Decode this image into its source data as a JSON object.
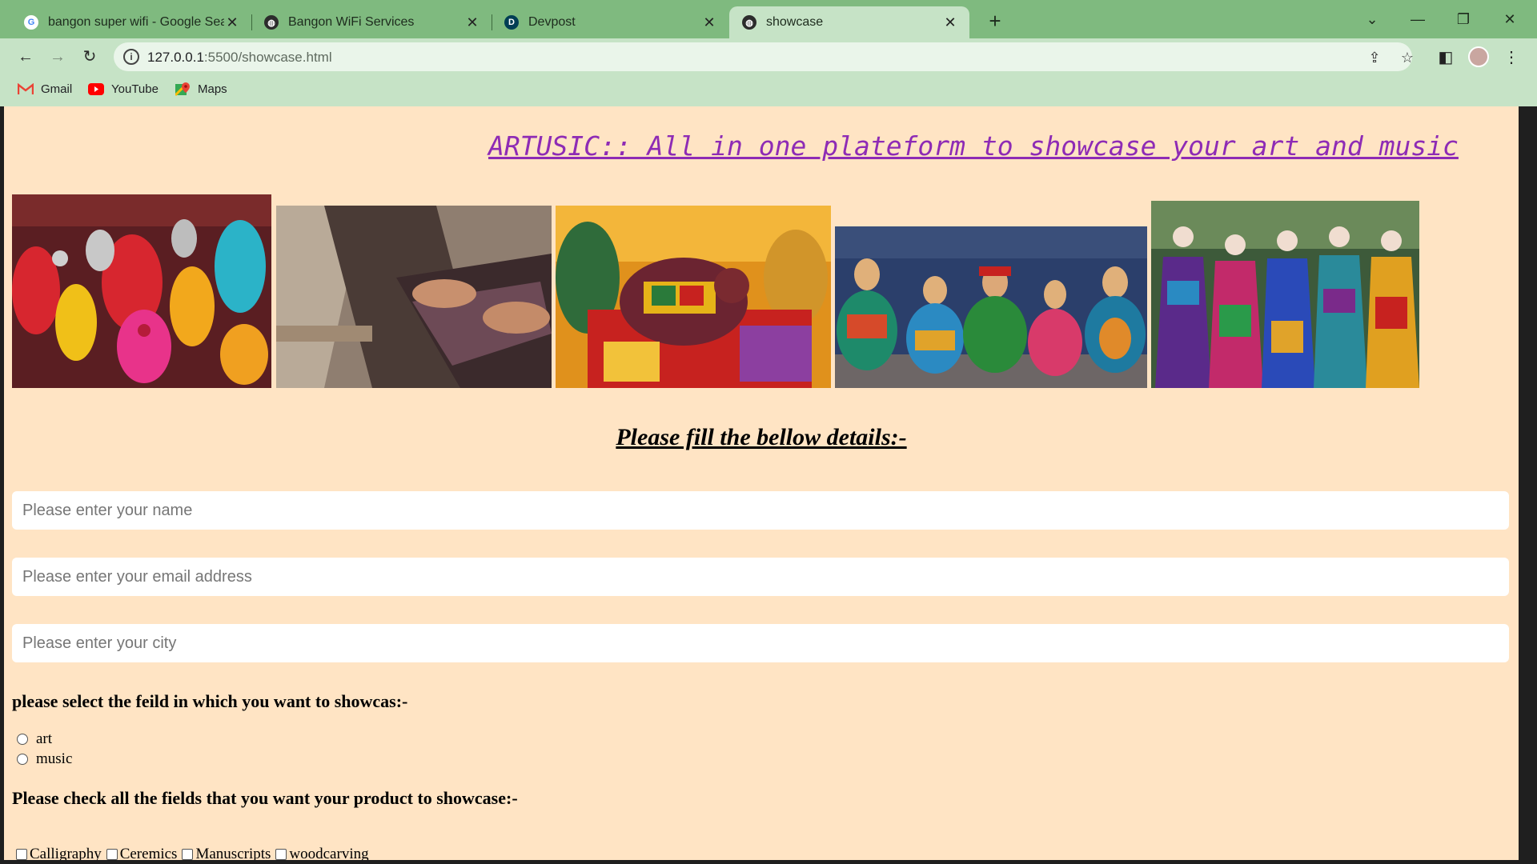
{
  "browser": {
    "tabs": [
      {
        "title": "bangon super wifi - Google Sear",
        "favicon": "google-g-icon"
      },
      {
        "title": "Bangon WiFi Services",
        "favicon": "globe-icon"
      },
      {
        "title": "Devpost",
        "favicon": "devpost-d-icon"
      },
      {
        "title": "showcase",
        "favicon": "globe-icon"
      }
    ],
    "active_tab": 3,
    "address": {
      "host": "127.0.0.1",
      "rest": ":5500/showcase.html"
    },
    "bookmarks": [
      {
        "label": "Gmail",
        "icon": "gmail-icon"
      },
      {
        "label": "YouTube",
        "icon": "youtube-icon"
      },
      {
        "label": "Maps",
        "icon": "maps-icon"
      }
    ]
  },
  "page": {
    "title": "ARTUSIC:: All in one plateform to showcase your art and music",
    "gallery": [
      "jewellery-photo",
      "weaving-loom-photo",
      "painted-elephant-photo",
      "musician-figurines-photo",
      "puppets-photo"
    ],
    "form_heading": "Please fill the bellow details:-",
    "inputs": {
      "name_placeholder": "Please enter your name",
      "email_placeholder": "Please enter your email address",
      "city_placeholder": "Please enter your city"
    },
    "field_question": "please select the feild in which you want to showcas:-",
    "field_options": [
      "art",
      "music"
    ],
    "checkbox_question": "Please check all the fields that you want your product to showcase:-",
    "checkbox_options": [
      "Calligraphy",
      "Ceremics",
      "Manuscripts",
      "woodcarving"
    ]
  },
  "colors": {
    "tab_strip": "#7fba7f",
    "toolbar": "#c6e3c6",
    "page_background": "#ffe4c4",
    "title_color": "#8e2bb5"
  }
}
